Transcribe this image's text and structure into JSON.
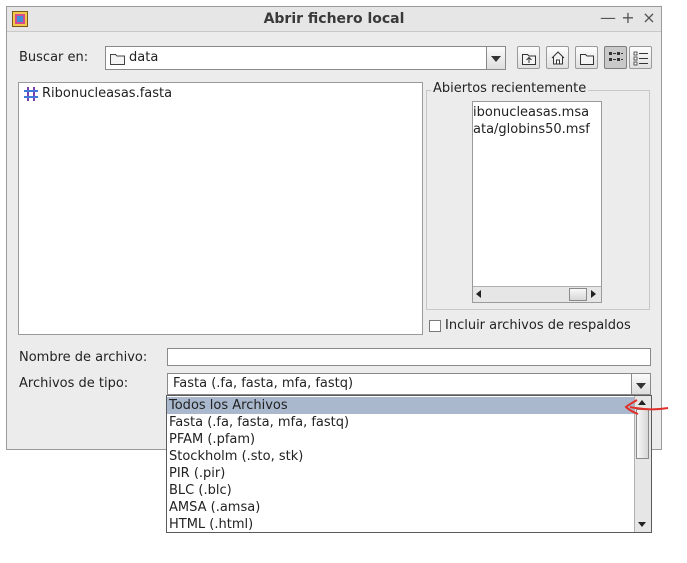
{
  "window": {
    "title": "Abrir fichero local",
    "controls": {
      "minimize": "—",
      "maximize": "+",
      "close": "×"
    }
  },
  "lookin": {
    "label": "Buscar en:",
    "value": "data"
  },
  "toolbar": {
    "buttons": [
      "up-folder-icon",
      "home-icon",
      "new-folder-icon",
      "list-view-icon",
      "details-view-icon"
    ]
  },
  "files": [
    {
      "name": "Ribonucleasas.fasta",
      "icon": "fasta-file-icon"
    }
  ],
  "recent": {
    "title": "Abiertos recientemente",
    "items": [
      "ibonucleasas.msa",
      "ata/globins50.msf"
    ]
  },
  "backup_checkbox": {
    "label": "Incluir archivos de respaldos",
    "checked": false
  },
  "filename": {
    "label": "Nombre de archivo:",
    "value": ""
  },
  "filetype": {
    "label": "Archivos de tipo:",
    "value": "Fasta (.fa, fasta, mfa, fastq)",
    "options": [
      "Todos los Archivos",
      "Fasta (.fa, fasta, mfa, fastq)",
      "PFAM (.pfam)",
      "Stockholm (.sto, stk)",
      "PIR (.pir)",
      "BLC (.blc)",
      "AMSA (.amsa)",
      "HTML (.html)"
    ],
    "highlighted_index": 0
  },
  "colors": {
    "dialog_bg": "#ececec",
    "selection_bg": "#a9b8cd",
    "annotation_red": "#e0302a"
  }
}
